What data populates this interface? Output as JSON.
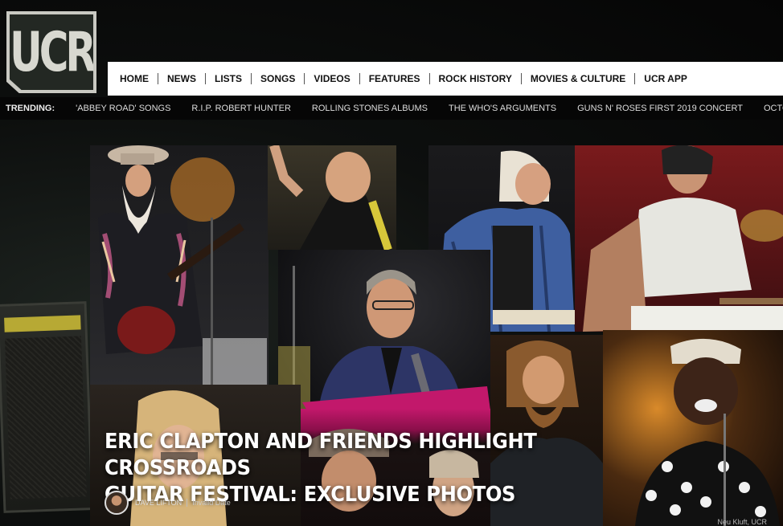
{
  "logo": {
    "text": "UCR"
  },
  "nav": {
    "items": [
      "HOME",
      "NEWS",
      "LISTS",
      "SONGS",
      "VIDEOS",
      "FEATURES",
      "ROCK HISTORY",
      "MOVIES & CULTURE",
      "UCR APP"
    ]
  },
  "trending": {
    "label": "TRENDING:",
    "items": [
      "'ABBEY ROAD' SONGS",
      "R.I.P. ROBERT HUNTER",
      "ROLLING STONES ALBUMS",
      "THE WHO'S ARGUMENTS",
      "GUNS N' ROSES FIRST 2019 CONCERT",
      "OCTOBER NEW MUSIC"
    ]
  },
  "article": {
    "headline_line1": "ERIC CLAPTON AND FRIENDS HIGHLIGHT CROSSROADS",
    "headline_line2": "GUITAR FESTIVAL: EXCLUSIVE PHOTOS",
    "author": "DAVE LIFTON",
    "date": "Invalid Date",
    "photo_credit": "Neu Kluft, UCR"
  },
  "colors": {
    "nav_bg": "#ffffff",
    "trending_bg": "#060606",
    "accent_pink": "#c2186b"
  }
}
